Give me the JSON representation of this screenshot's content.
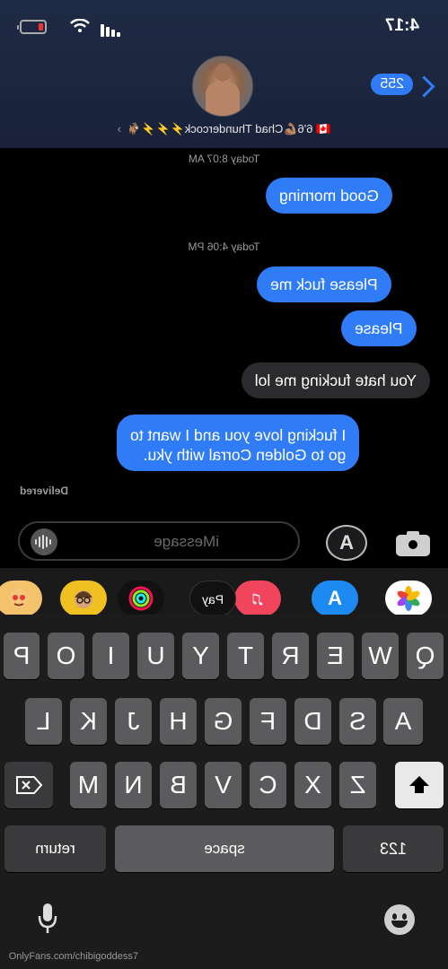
{
  "status": {
    "time": "4:17"
  },
  "nav": {
    "back_count": "255"
  },
  "contact": {
    "name": "🇨🇦 6'6💪🏽Chad Thundercock⚡⚡⚡🐐"
  },
  "thread": {
    "stamp1": "Today 8:07 AM",
    "msg1": "Good morning",
    "stamp2": "Today 4:06 PM",
    "msg2": "Please fuck me",
    "msg3": "Please",
    "msg4": "You hate fucking me lol",
    "msg5_line1": "I fucking love you and I want to",
    "msg5_line2": "go to Golden Corral with yku.",
    "delivered": "Delivered"
  },
  "input": {
    "placeholder": "iMessage"
  },
  "apps": {
    "pay": "Pay"
  },
  "keyboard": {
    "row1": [
      "Q",
      "W",
      "E",
      "R",
      "T",
      "Y",
      "U",
      "I",
      "O",
      "P"
    ],
    "row2": [
      "A",
      "S",
      "D",
      "F",
      "G",
      "H",
      "J",
      "K",
      "L"
    ],
    "row3": [
      "Z",
      "X",
      "C",
      "V",
      "B",
      "N",
      "M"
    ],
    "numbers": "123",
    "space": "space",
    "return": "return"
  },
  "watermark": "OnlyFans.com/chibigoddess7",
  "icons": [
    "battery-icon",
    "wifi-icon",
    "signal-icon",
    "back-chevron-icon",
    "camera-icon",
    "app-store-icon",
    "audio-wave-icon",
    "photos-icon",
    "music-icon",
    "fitness-icon",
    "memoji-icon",
    "shift-icon",
    "delete-icon",
    "mic-icon",
    "emoji-icon"
  ],
  "colors": {
    "bubble_blue": "#2f7cf6",
    "bubble_gray": "#2b2b2d",
    "header": "#1f2a44"
  }
}
